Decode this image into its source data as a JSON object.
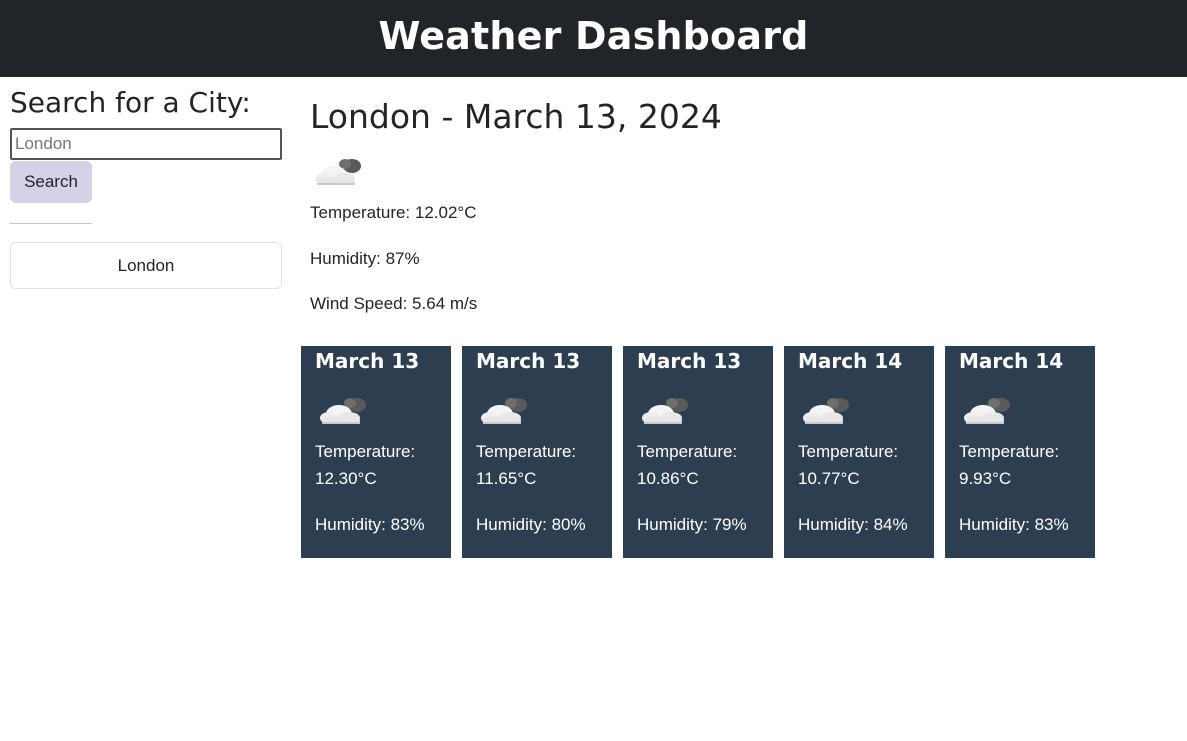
{
  "header": {
    "title": "Weather Dashboard"
  },
  "sidebar": {
    "heading": "Search for a City:",
    "search_placeholder": "London",
    "search_button_label": "Search",
    "history": [
      "London"
    ]
  },
  "current": {
    "title": "London - March 13, 2024",
    "icon": "cloud-icon",
    "temperature": "Temperature: 12.02°C",
    "humidity": "Humidity: 87%",
    "wind": "Wind Speed: 5.64 m/s"
  },
  "forecast": [
    {
      "date": "March 13",
      "icon": "cloud-icon",
      "temp_label": "Temperature:",
      "temp_value": "12.30°C",
      "humidity": "Humidity: 83%"
    },
    {
      "date": "March 13",
      "icon": "cloud-icon",
      "temp_label": "Temperature:",
      "temp_value": "11.65°C",
      "humidity": "Humidity: 80%"
    },
    {
      "date": "March 13",
      "icon": "cloud-icon",
      "temp_label": "Temperature:",
      "temp_value": "10.86°C",
      "humidity": "Humidity: 79%"
    },
    {
      "date": "March 14",
      "icon": "cloud-icon",
      "temp_label": "Temperature:",
      "temp_value": "10.77°C",
      "humidity": "Humidity: 84%"
    },
    {
      "date": "March 14",
      "icon": "cloud-icon",
      "temp_label": "Temperature:",
      "temp_value": "9.93°C",
      "humidity": "Humidity: 83%"
    }
  ],
  "colors": {
    "header_bg": "#212529",
    "card_bg": "#2d3e50",
    "search_button_bg": "#d4d2e6"
  }
}
